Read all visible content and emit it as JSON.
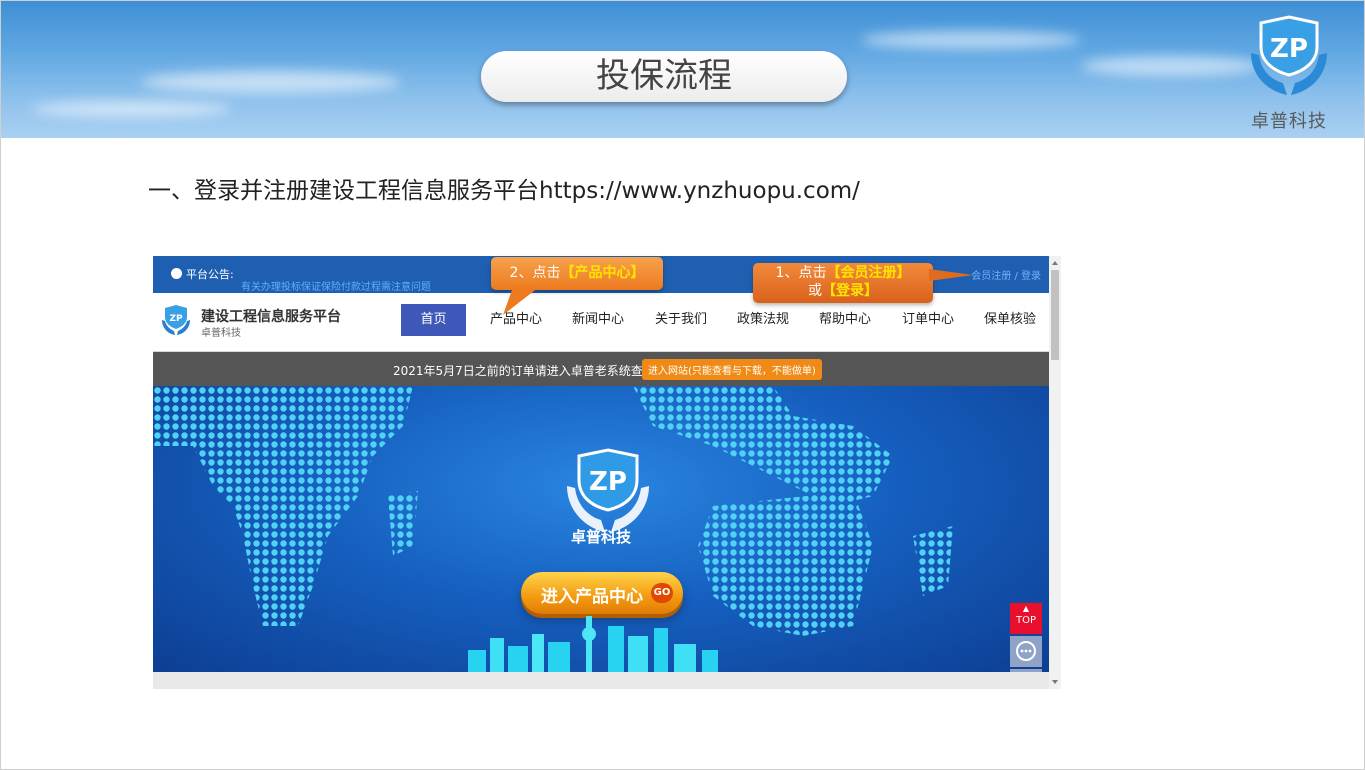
{
  "slide": {
    "title": "投保流程",
    "brand_name": "卓普科技",
    "step_text": "一、登录并注册建设工程信息服务平台https://www.ynzhuopu.com/"
  },
  "website": {
    "notice_label": "平台公告:",
    "notice_marquee": "有关办理投标保证保险付款过程需注意问题",
    "login_links": "会员注册 / 登录",
    "site_name": "建设工程信息服务平台",
    "site_sub": "卓普科技",
    "nav": [
      "首页",
      "产品中心",
      "新闻中心",
      "关于我们",
      "政策法规",
      "帮助中心",
      "订单中心",
      "保单核验"
    ],
    "old_notice": "2021年5月7日之前的订单请进入卓普老系统查看",
    "old_button": "进入网站(只能查看与下载，不能做单)",
    "hero_brand": "卓普科技",
    "enter_button": "进入产品中心",
    "go_badge": "GO",
    "float_top": "TOP"
  },
  "callouts": {
    "step2_prefix": "2、点击",
    "step2_highlight": "【产品中心】",
    "step1_prefix": "1、点击",
    "step1_highlight1": "【会员注册】",
    "step1_or": "或",
    "step1_highlight2": "【登录】"
  },
  "colors": {
    "accent_blue": "#3d58b8",
    "callout_orange": "#ed7a1f",
    "highlight_yellow": "#ffe400",
    "top_red": "#e8102c"
  },
  "icons": [
    "zp-logo-icon",
    "notice-icon",
    "customer-service-icon",
    "qrcode-icon",
    "scroll-arrow-icon"
  ]
}
